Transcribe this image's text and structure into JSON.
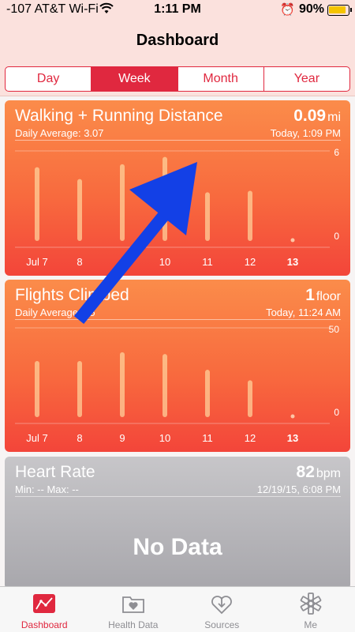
{
  "status_bar": {
    "carrier": "-107 AT&T Wi-Fi",
    "time": "1:11 PM",
    "battery": "90%",
    "battery_level": 0.9
  },
  "nav": {
    "title": "Dashboard"
  },
  "segments": [
    {
      "label": "Day",
      "active": false
    },
    {
      "label": "Week",
      "active": true
    },
    {
      "label": "Month",
      "active": false
    },
    {
      "label": "Year",
      "active": false
    }
  ],
  "cards": {
    "walking": {
      "title": "Walking + Running Distance",
      "value": "0.09",
      "unit": "mi",
      "subtitle_left": "Daily Average: 3.07",
      "subtitle_right": "Today, 1:09 PM",
      "color": "#f86a3e"
    },
    "flights": {
      "title": "Flights Climbed",
      "value": "1",
      "unit": "floor",
      "subtitle_left": "Daily Average: 25",
      "subtitle_right": "Today, 11:24 AM",
      "color": "#f86a3e"
    },
    "heart": {
      "title": "Heart Rate",
      "value": "82",
      "unit": "bpm",
      "subtitle_left": "Min: --   Max: --",
      "subtitle_right": "12/19/15, 6:08 PM",
      "no_data": "No Data",
      "color": "#b8b7bb"
    }
  },
  "chart_data": [
    {
      "type": "bar",
      "categories": [
        "Jul 7",
        "8",
        "9",
        "10",
        "11",
        "12",
        "13"
      ],
      "highlight_category": "13",
      "values": [
        5.0,
        4.2,
        5.2,
        5.7,
        3.3,
        3.4,
        0.09
      ],
      "ylim": [
        0,
        6
      ],
      "ytick_labels": [
        "6",
        "0"
      ]
    },
    {
      "type": "bar",
      "categories": [
        "Jul 7",
        "8",
        "9",
        "10",
        "11",
        "12",
        "13"
      ],
      "highlight_category": "13",
      "values": [
        32,
        32,
        37,
        36,
        27,
        21,
        1
      ],
      "ylim": [
        0,
        50
      ],
      "ytick_labels": [
        "50",
        "0"
      ]
    }
  ],
  "tabs": [
    {
      "label": "Dashboard",
      "icon": "chart-icon",
      "active": true
    },
    {
      "label": "Health Data",
      "icon": "folder-heart-icon",
      "active": false
    },
    {
      "label": "Sources",
      "icon": "download-heart-icon",
      "active": false
    },
    {
      "label": "Me",
      "icon": "medical-star-icon",
      "active": false
    }
  ],
  "colors": {
    "accent": "#e0283f",
    "annotation_arrow": "#1340e6"
  }
}
